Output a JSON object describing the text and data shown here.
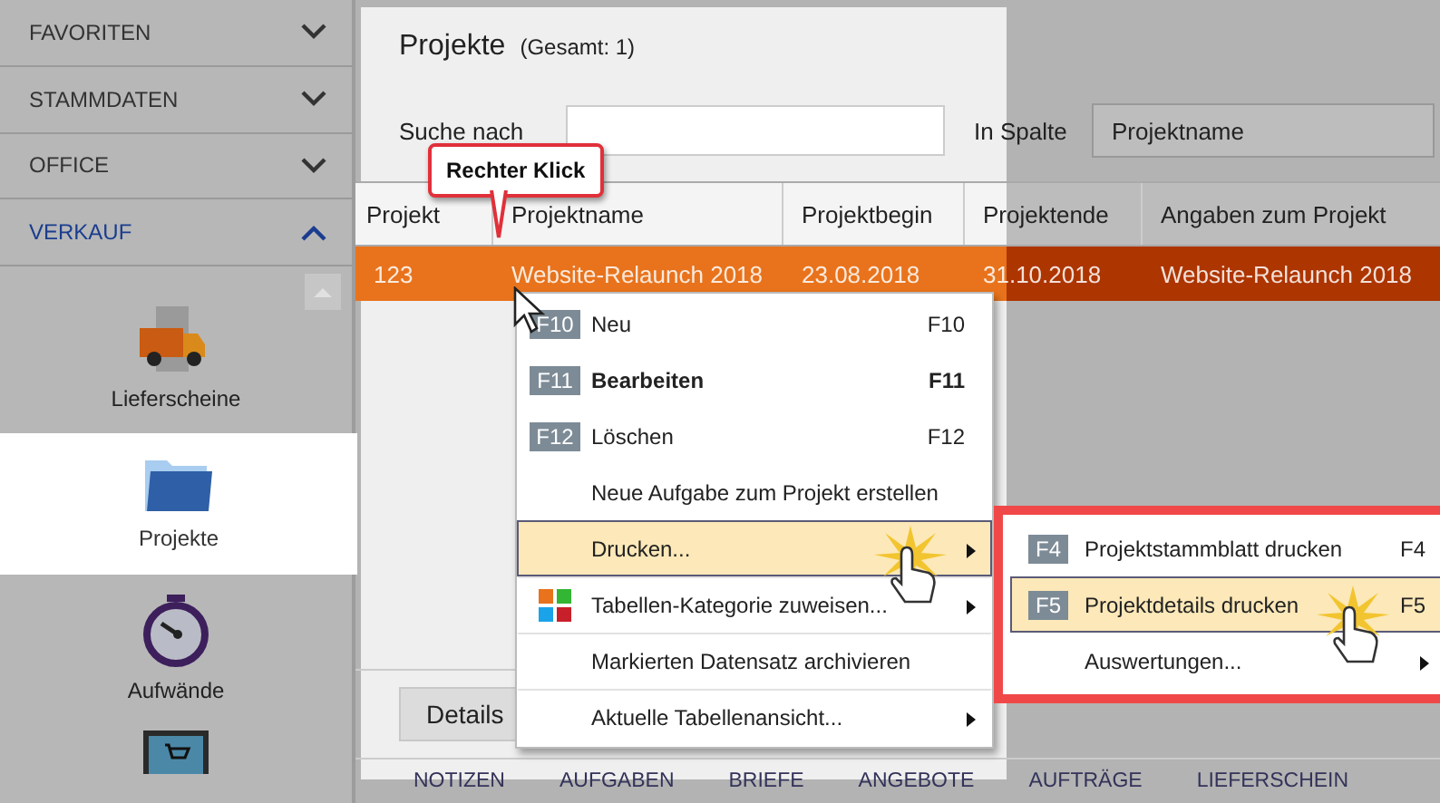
{
  "sidebar": {
    "sections": [
      {
        "label": "FAVORITEN",
        "expanded": false
      },
      {
        "label": "STAMMDATEN",
        "expanded": false
      },
      {
        "label": "OFFICE",
        "expanded": false
      },
      {
        "label": "VERKAUF",
        "expanded": true
      }
    ],
    "items": [
      {
        "kind": "truck",
        "label": "Lieferscheine",
        "selected": false
      },
      {
        "kind": "folder",
        "label": "Projekte",
        "selected": true
      },
      {
        "kind": "stopwatch",
        "label": "Aufwände",
        "selected": false
      },
      {
        "kind": "laptop",
        "selected": false
      }
    ]
  },
  "header": {
    "title": "Projekte",
    "count": "(Gesamt: 1)"
  },
  "search": {
    "label": "Suche nach",
    "column_label": "In Spalte",
    "column_value": "Projektname"
  },
  "table": {
    "columns": [
      "Projekt",
      "Projektname",
      "Projektbegin",
      "Projektende",
      "Angaben zum Projekt"
    ],
    "rows": [
      {
        "cells": [
          "123",
          "Website-Relaunch 2018",
          "23.08.2018",
          "31.10.2018",
          "Website-Relaunch 2018"
        ],
        "selected": true
      }
    ]
  },
  "details_button": "Details",
  "bottom_tabs": [
    "NOTIZEN",
    "AUFGABEN",
    "BRIEFE",
    "ANGEBOTE",
    "AUFTRÄGE",
    "LIEFERSCHEIN"
  ],
  "tooltip": "Rechter Klick",
  "context_menu": {
    "items": [
      {
        "kind": "key",
        "badge": "F10",
        "label": "Neu",
        "shortcut": "F10",
        "bold": false,
        "submenu": false,
        "selected": false
      },
      {
        "kind": "key",
        "badge": "F11",
        "label": "Bearbeiten",
        "shortcut": "F11",
        "bold": true,
        "submenu": false,
        "selected": false
      },
      {
        "kind": "key",
        "badge": "F12",
        "label": "Löschen",
        "shortcut": "F12",
        "bold": false,
        "submenu": false,
        "selected": false
      },
      {
        "kind": "plain",
        "label": "Neue Aufgabe zum Projekt erstellen",
        "bold": false,
        "submenu": false,
        "selected": false
      },
      {
        "kind": "plain",
        "label": "Drucken...",
        "bold": false,
        "submenu": true,
        "selected": true
      },
      {
        "kind": "tiles",
        "label": "Tabellen-Kategorie zuweisen...",
        "bold": false,
        "submenu": true,
        "selected": false
      },
      {
        "kind": "plain",
        "label": "Markierten Datensatz archivieren",
        "bold": false,
        "submenu": false,
        "selected": false
      },
      {
        "kind": "plain",
        "label": "Aktuelle Tabellenansicht...",
        "bold": false,
        "submenu": true,
        "selected": false
      }
    ]
  },
  "submenu": {
    "items": [
      {
        "kind": "key",
        "badge": "F4",
        "label": "Projektstammblatt drucken",
        "shortcut": "F4",
        "bold": false,
        "submenu": false,
        "selected": false
      },
      {
        "kind": "key",
        "badge": "F5",
        "label": "Projektdetails drucken",
        "shortcut": "F5",
        "bold": false,
        "submenu": false,
        "selected": true
      },
      {
        "kind": "plain",
        "label": "Auswertungen...",
        "bold": false,
        "submenu": true,
        "selected": false
      }
    ]
  }
}
